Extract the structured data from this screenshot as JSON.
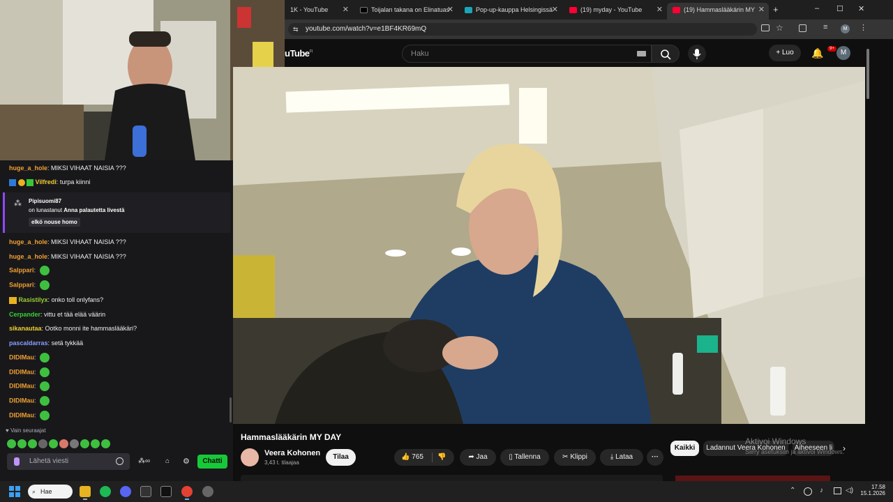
{
  "browser": {
    "tabs": [
      {
        "label": "1K - YouTube",
        "fav": "#ff0033"
      },
      {
        "label": "Toijalan takana on Elinatuas",
        "fav": "#000000"
      },
      {
        "label": "Pop-up-kauppa Helsingissä",
        "fav": "#1aa6b7"
      },
      {
        "label": "(19) myday - YouTube",
        "fav": "#ff0033"
      },
      {
        "label": "(19) Hammaslääkärin MY",
        "fav": "#ff0033"
      }
    ],
    "url": "youtube.com/watch?v=e1BF4KR69mQ",
    "window_controls": [
      "–",
      "☐",
      "✕"
    ]
  },
  "youtube": {
    "logo": "uTube",
    "logo_region": "FI",
    "search_placeholder": "Haku",
    "create_label": "Luo",
    "notif_badge": "9+",
    "avatar_letter": "M",
    "video_title": "Hammaslääkärin MY DAY",
    "channel_name": "Veera Kohonen",
    "subscribers": "3,43 t. tilaajaa",
    "subscribe_label": "Tilaa",
    "likes": "765",
    "share_label": "Jaa",
    "save_label": "Tallenna",
    "clip_label": "Klippi",
    "download_label": "Lataa",
    "chips": [
      "Kaikki",
      "Ladannut Veera Kohonen",
      "Aiheeseen li"
    ],
    "activation_title": "Aktivoi Windows",
    "activation_sub": "Siirry asetuksiin ja aktivoi Windows."
  },
  "chat": {
    "messages": [
      {
        "user": "huge_a_hole",
        "color": "#f0a030",
        "text": "MIKSI VIHAAT NAISIA ???"
      },
      {
        "user": "Vilfredi",
        "color": "#f0d030",
        "text": "turpa kiinni"
      },
      {
        "user": "huge_a_hole",
        "color": "#f0a030",
        "text": "MIKSI VIHAAT NAISIA ???"
      },
      {
        "user": "huge_a_hole",
        "color": "#f0a030",
        "text": "MIKSI VIHAAT NAISIA ???"
      },
      {
        "user": "Salppari",
        "color": "#f0a030",
        "text": ""
      },
      {
        "user": "Salppari",
        "color": "#f0a030",
        "text": ""
      },
      {
        "user": "Rasistilyx",
        "color": "#9acd32",
        "text": "onko toll onlyfans?"
      },
      {
        "user": "Cerpander",
        "color": "#37d137",
        "text": "vittu et tää elää väärin"
      },
      {
        "user": "sikanautaa",
        "color": "#f0d030",
        "text": "Ootko monni ite hammaslääkäri?"
      },
      {
        "user": "pascaldarras",
        "color": "#8a9cff",
        "text": "setä tykkää"
      },
      {
        "user": "DIDIMau",
        "color": "#f0a030",
        "text": ""
      },
      {
        "user": "DIDIMau",
        "color": "#f0a030",
        "text": ""
      },
      {
        "user": "DIDIMau",
        "color": "#f0a030",
        "text": ""
      },
      {
        "user": "DIDIMau",
        "color": "#f0a030",
        "text": ""
      },
      {
        "user": "DIDIMau",
        "color": "#f0a030",
        "text": ""
      }
    ],
    "redemption": {
      "user": "Pipisuomi87",
      "action": "on lunastanut",
      "reward": "Anna palautetta livestä",
      "text": "elkö nouse homo"
    },
    "followers_only": "Vain seuraajat",
    "input_placeholder": "Lähetä viesti",
    "send_label": "Chatti"
  },
  "taskbar": {
    "search_label": "Hae",
    "time": "17.58",
    "date": "15.1.2026"
  }
}
